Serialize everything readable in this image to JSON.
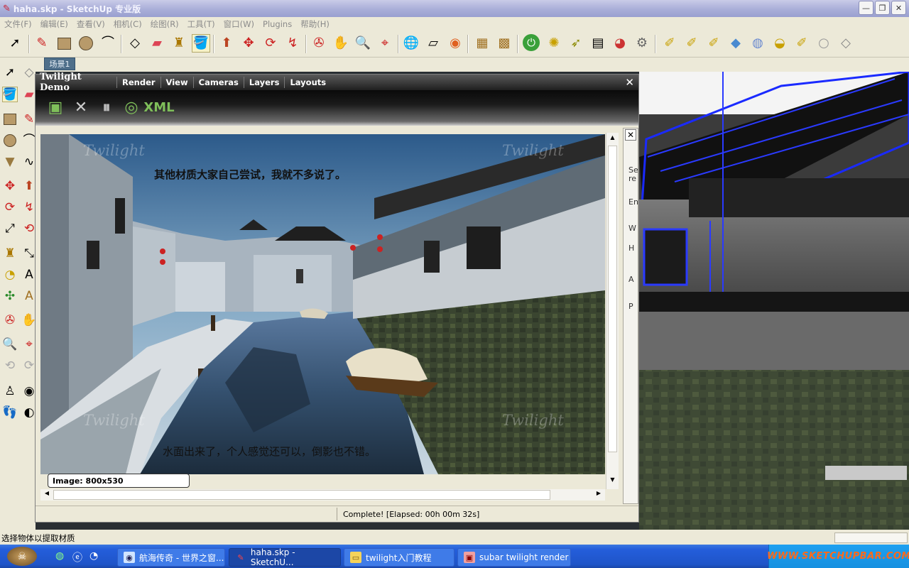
{
  "window": {
    "title": "haha.skp - SketchUp 专业版",
    "min": "—",
    "max": "❐",
    "close": "✕"
  },
  "menu": [
    "文件(F)",
    "编辑(E)",
    "查看(V)",
    "相机(C)",
    "绘图(R)",
    "工具(T)",
    "窗口(W)",
    "Plugins",
    "帮助(H)"
  ],
  "scene_tab": "场景1",
  "twilight": {
    "title": "Twilight Demo",
    "menus": [
      "Render",
      "View",
      "Cameras",
      "Layers",
      "Layouts"
    ],
    "close": "✕",
    "tools": {
      "capture": "▣",
      "stop": "✕",
      "pause": "⏸",
      "refresh": "◎",
      "xml": "XML"
    },
    "watermark": "Twilight",
    "caption_top": "其他材质大家自己尝试，我就不多说了。",
    "caption_bottom": "水面出来了，个人感觉还可以，倒影也不错。",
    "image_size": "Image: 800x530",
    "status": "Complete!  [Elapsed: 00h 00m 32s]"
  },
  "side_panel": {
    "close": "✕",
    "labels": [
      "Se",
      "re",
      "En",
      "W",
      "H",
      "A",
      "P"
    ]
  },
  "statusbar": "选择物体以提取材质",
  "taskbar": {
    "items": [
      {
        "label": "航海传奇 - 世界之窗..."
      },
      {
        "label": "haha.skp - SketchU..."
      },
      {
        "label": "twilight入门教程"
      },
      {
        "label": "subar twilight  render"
      }
    ],
    "brand": "WWW.SKETCHUPBAR.COM"
  },
  "colors": {
    "accent_blue": "#245edb",
    "brand": "#ff6a1a",
    "twilight_green": "#7fbf5a"
  }
}
